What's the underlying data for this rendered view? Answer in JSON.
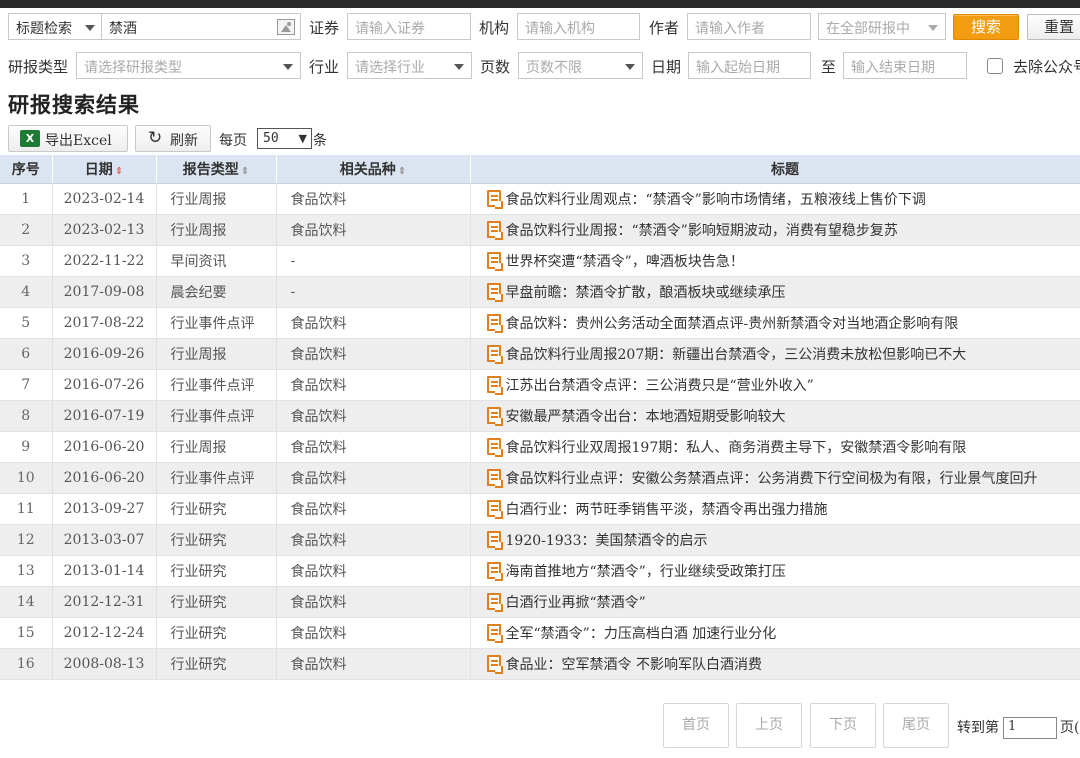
{
  "search": {
    "type_label": "标题检索",
    "keyword": "禁酒",
    "security_label": "证券",
    "security_placeholder": "请输入证券",
    "org_label": "机构",
    "org_placeholder": "请输入机构",
    "author_label": "作者",
    "author_placeholder": "请输入作者",
    "scope": "在全部研报中",
    "search_button": "搜索",
    "reset_button": "重置"
  },
  "filters": {
    "report_type_label": "研报类型",
    "report_type_placeholder": "请选择研报类型",
    "industry_label": "行业",
    "industry_placeholder": "请选择行业",
    "pages_label": "页数",
    "pages_placeholder": "页数不限",
    "date_label": "日期",
    "start_placeholder": "输入起始日期",
    "to_label": "至",
    "end_placeholder": "输入结束日期",
    "exclude_label": "去除公众号"
  },
  "heading": "研报搜索结果",
  "toolbar": {
    "export_label": "导出Excel",
    "refresh_label": "刷新",
    "per_page_label": "每页",
    "per_page_value": "50",
    "per_page_suffix": "条"
  },
  "table": {
    "columns": {
      "idx": "序号",
      "date": "日期",
      "type": "报告类型",
      "variety": "相关品种",
      "title": "标题"
    },
    "rows": [
      {
        "idx": "1",
        "date": "2023-02-14",
        "type": "行业周报",
        "variety": "食品饮料",
        "title": "食品饮料行业周观点：“禁酒令”影响市场情绪，五粮液线上售价下调"
      },
      {
        "idx": "2",
        "date": "2023-02-13",
        "type": "行业周报",
        "variety": "食品饮料",
        "title": "食品饮料行业周报：“禁酒令”影响短期波动，消费有望稳步复苏"
      },
      {
        "idx": "3",
        "date": "2022-11-22",
        "type": "早间资讯",
        "variety": "-",
        "title": "世界杯突遭“禁酒令”，啤酒板块告急！"
      },
      {
        "idx": "4",
        "date": "2017-09-08",
        "type": "晨会纪要",
        "variety": "-",
        "title": "早盘前瞻：禁酒令扩散，酿酒板块或继续承压"
      },
      {
        "idx": "5",
        "date": "2017-08-22",
        "type": "行业事件点评",
        "variety": "食品饮料",
        "title": "食品饮料：贵州公务活动全面禁酒点评-贵州新禁酒令对当地酒企影响有限"
      },
      {
        "idx": "6",
        "date": "2016-09-26",
        "type": "行业周报",
        "variety": "食品饮料",
        "title": "食品饮料行业周报207期：新疆出台禁酒令，三公消费未放松但影响已不大"
      },
      {
        "idx": "7",
        "date": "2016-07-26",
        "type": "行业事件点评",
        "variety": "食品饮料",
        "title": "江苏出台禁酒令点评：三公消费只是“营业外收入”"
      },
      {
        "idx": "8",
        "date": "2016-07-19",
        "type": "行业事件点评",
        "variety": "食品饮料",
        "title": "安徽最严禁酒令出台：本地酒短期受影响较大"
      },
      {
        "idx": "9",
        "date": "2016-06-20",
        "type": "行业周报",
        "variety": "食品饮料",
        "title": "食品饮料行业双周报197期：私人、商务消费主导下，安徽禁酒令影响有限"
      },
      {
        "idx": "10",
        "date": "2016-06-20",
        "type": "行业事件点评",
        "variety": "食品饮料",
        "title": "食品饮料行业点评：安徽公务禁酒点评：公务消费下行空间极为有限，行业景气度回升"
      },
      {
        "idx": "11",
        "date": "2013-09-27",
        "type": "行业研究",
        "variety": "食品饮料",
        "title": "白酒行业：两节旺季销售平淡，禁酒令再出强力措施"
      },
      {
        "idx": "12",
        "date": "2013-03-07",
        "type": "行业研究",
        "variety": "食品饮料",
        "title": "1920-1933：美国禁酒令的启示"
      },
      {
        "idx": "13",
        "date": "2013-01-14",
        "type": "行业研究",
        "variety": "食品饮料",
        "title": "海南首推地方“禁酒令”，行业继续受政策打压"
      },
      {
        "idx": "14",
        "date": "2012-12-31",
        "type": "行业研究",
        "variety": "食品饮料",
        "title": "白酒行业再掀“禁酒令”"
      },
      {
        "idx": "15",
        "date": "2012-12-24",
        "type": "行业研究",
        "variety": "食品饮料",
        "title": "全军“禁酒令”：力压高档白酒 加速行业分化"
      },
      {
        "idx": "16",
        "date": "2008-08-13",
        "type": "行业研究",
        "variety": "食品饮料",
        "title": "食品业：空军禁酒令 不影响军队白酒消费"
      }
    ]
  },
  "pager": {
    "first": "首页",
    "prev": "上页",
    "next": "下页",
    "last": "尾页",
    "goto_label": "转到第",
    "page_value": "1",
    "page_suffix": "页("
  }
}
